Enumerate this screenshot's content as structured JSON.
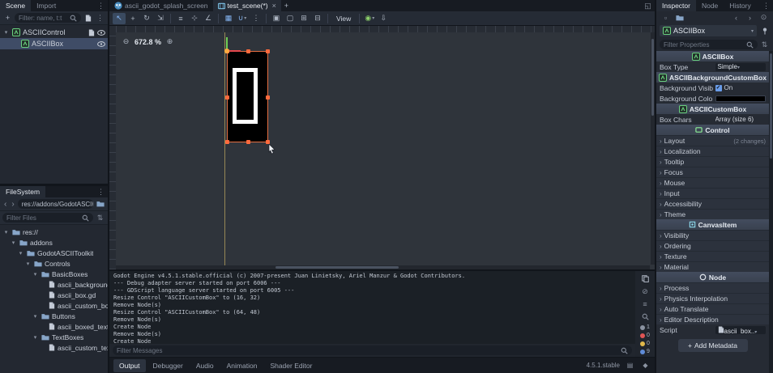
{
  "colors": {
    "accent": "#699ce8",
    "selection_orange": "#ff6a3d",
    "guide_yellow": "#e6c15a",
    "background_swatch": "#000000"
  },
  "scene_dock": {
    "tabs": [
      {
        "label": "Scene",
        "active": true
      },
      {
        "label": "Import",
        "active": false
      }
    ],
    "filter_placeholder": "Filter: name, t:t",
    "tree": [
      {
        "label": "ASCIIControl",
        "indent": 0,
        "expanded": true,
        "selected": false,
        "right_icons": [
          "script-icon",
          "eye-icon"
        ]
      },
      {
        "label": "ASCIIBox",
        "indent": 1,
        "selected": true,
        "right_icons": [
          "eye-icon"
        ]
      }
    ]
  },
  "filesystem_dock": {
    "title": "FileSystem",
    "path": "res://addons/GodotASCIIT",
    "filter_placeholder": "Filter Files",
    "tree": [
      {
        "label": "res://",
        "indent": 0,
        "type": "folder",
        "expanded": true
      },
      {
        "label": "addons",
        "indent": 1,
        "type": "folder",
        "expanded": true
      },
      {
        "label": "GodotASCIIToolkit",
        "indent": 2,
        "type": "folder",
        "expanded": true
      },
      {
        "label": "Controls",
        "indent": 3,
        "type": "folder",
        "expanded": true
      },
      {
        "label": "BasicBoxes",
        "indent": 4,
        "type": "folder",
        "expanded": true
      },
      {
        "label": "ascii_background_c...",
        "indent": 5,
        "type": "script"
      },
      {
        "label": "ascii_box.gd",
        "indent": 5,
        "type": "script"
      },
      {
        "label": "ascii_custom_box.gd",
        "indent": 5,
        "type": "script"
      },
      {
        "label": "Buttons",
        "indent": 4,
        "type": "folder",
        "expanded": true
      },
      {
        "label": "ascii_boxed_text_bu...",
        "indent": 5,
        "type": "script"
      },
      {
        "label": "TextBoxes",
        "indent": 4,
        "type": "folder",
        "expanded": true
      },
      {
        "label": "ascii_custom_text_b...",
        "indent": 5,
        "type": "script"
      }
    ]
  },
  "editor": {
    "scene_tabs": [
      {
        "label": "ascii_godot_splash_screen",
        "icon": "godot",
        "active": false,
        "closable": false
      },
      {
        "label": "test_scene(*)",
        "icon": "scenefile",
        "active": true,
        "closable": true
      }
    ],
    "toolbar": {
      "view_label": "View",
      "items": [
        {
          "name": "select-tool-icon",
          "glyph": "↖",
          "active": true
        },
        {
          "name": "move-tool-icon",
          "glyph": "+"
        },
        {
          "name": "rotate-tool-icon",
          "glyph": "↻"
        },
        {
          "name": "scale-tool-icon",
          "glyph": "⇲"
        },
        {
          "type": "sep"
        },
        {
          "name": "list-select-tool-icon",
          "glyph": "≡"
        },
        {
          "name": "pan-tool-icon",
          "glyph": "⊹"
        },
        {
          "name": "ruler-tool-icon",
          "glyph": "∠"
        },
        {
          "type": "sep"
        },
        {
          "name": "smart-snap-icon",
          "glyph": "▦",
          "accent": true
        },
        {
          "name": "grid-snap-icon",
          "glyph": "∪",
          "accent": true,
          "dropdown": true
        },
        {
          "name": "snap-options-icon",
          "glyph": "⋮"
        },
        {
          "type": "sep"
        },
        {
          "name": "lock-selected-icon",
          "glyph": "▣"
        },
        {
          "name": "unlock-selected-icon",
          "glyph": "▢"
        },
        {
          "name": "group-selected-icon",
          "glyph": "⊞"
        },
        {
          "name": "ungroup-selected-icon",
          "glyph": "⊟"
        },
        {
          "type": "sep"
        },
        {
          "type": "view"
        },
        {
          "type": "sep"
        },
        {
          "name": "preview-toggle-icon",
          "glyph": "◉",
          "green": true,
          "dropdown": true
        },
        {
          "name": "overlay-menu-icon",
          "glyph": "⇩"
        }
      ]
    },
    "canvas": {
      "zoom": "672.8 %",
      "zoom_out_glyph": "⊖",
      "zoom_in_glyph": "⊕"
    }
  },
  "output": {
    "lines": [
      "Godot Engine v4.5.1.stable.official (c) 2007-present Juan Linietsky, Ariel Manzur & Godot Contributors.",
      "--- Debug adapter server started on port 6006 ---",
      "--- GDScript language server started on port 6005 ---",
      "Resize Control \"ASCIICustomBox\" to (16, 32)",
      "Remove Node(s)",
      "Resize Control \"ASCIICustomBox\" to (64, 48)",
      "Remove Node(s)",
      "Create Node",
      "Remove Node(s)",
      "Create Node"
    ],
    "filter_placeholder": "Filter Messages",
    "side_icons": [
      {
        "name": "copy-log-icon",
        "svg": "copy"
      },
      {
        "name": "clear-log-icon",
        "glyph": "⊘"
      },
      {
        "name": "collapse-duplicates-icon",
        "glyph": "≡"
      },
      {
        "name": "search-log-icon",
        "svg": "search"
      }
    ],
    "counters": [
      {
        "name": "std-messages-count",
        "value": "1",
        "color": "#8b93a1"
      },
      {
        "name": "errors-count",
        "value": "0",
        "color": "#e05555"
      },
      {
        "name": "warnings-count",
        "value": "0",
        "color": "#e0b84b"
      },
      {
        "name": "messages-count",
        "value": "9",
        "color": "#5f8bd6"
      }
    ]
  },
  "statusbar": {
    "tabs": [
      {
        "label": "Output",
        "active": true
      },
      {
        "label": "Debugger",
        "active": false
      },
      {
        "label": "Audio",
        "active": false
      },
      {
        "label": "Animation",
        "active": false
      },
      {
        "label": "Shader Editor",
        "active": false
      }
    ],
    "version": "4.5.1.stable",
    "right_icons": [
      {
        "name": "panel-pin-icon",
        "glyph": "▤"
      },
      {
        "name": "panel-expand-icon",
        "glyph": "◆"
      }
    ]
  },
  "inspector": {
    "tabs": [
      {
        "label": "Inspector",
        "active": true
      },
      {
        "label": "Node",
        "active": false
      },
      {
        "label": "History",
        "active": false
      }
    ],
    "node_name": "ASCIIBox",
    "filter_placeholder": "Filter Properties",
    "rows": [
      {
        "type": "category",
        "label": "ASCIIBox",
        "icon": "ag"
      },
      {
        "type": "property",
        "label": "Box Type",
        "value": "Simple",
        "control": "dropdown"
      },
      {
        "type": "category",
        "label": "ASCIIBackgroundCustomBox",
        "icon": "ag"
      },
      {
        "type": "property",
        "label": "Background Visib",
        "value": "On",
        "control": "checkbox"
      },
      {
        "type": "property",
        "label": "Background Colo",
        "value": "#000000",
        "control": "color"
      },
      {
        "type": "category",
        "label": "ASCIICustomBox",
        "icon": "ag"
      },
      {
        "type": "property",
        "label": "Box Chars",
        "value": "Array (size 6)",
        "control": "array"
      },
      {
        "type": "category",
        "label": "Control",
        "icon": "control"
      },
      {
        "type": "section",
        "label": "Layout",
        "note": "(2 changes)"
      },
      {
        "type": "section",
        "label": "Localization"
      },
      {
        "type": "section",
        "label": "Tooltip"
      },
      {
        "type": "section",
        "label": "Focus"
      },
      {
        "type": "section",
        "label": "Mouse"
      },
      {
        "type": "section",
        "label": "Input"
      },
      {
        "type": "section",
        "label": "Accessibility"
      },
      {
        "type": "section",
        "label": "Theme"
      },
      {
        "type": "category",
        "label": "CanvasItem",
        "icon": "canvasitem"
      },
      {
        "type": "section",
        "label": "Visibility"
      },
      {
        "type": "section",
        "label": "Ordering"
      },
      {
        "type": "section",
        "label": "Texture"
      },
      {
        "type": "section",
        "label": "Material"
      },
      {
        "type": "category",
        "label": "Node",
        "icon": "node"
      },
      {
        "type": "section",
        "label": "Process"
      },
      {
        "type": "section",
        "label": "Physics Interpolation"
      },
      {
        "type": "section",
        "label": "Auto Translate"
      },
      {
        "type": "section",
        "label": "Editor Description"
      },
      {
        "type": "property",
        "label": "Script",
        "value": "ascii_box..",
        "control": "script"
      },
      {
        "type": "button",
        "label": "Add Metadata"
      }
    ]
  }
}
